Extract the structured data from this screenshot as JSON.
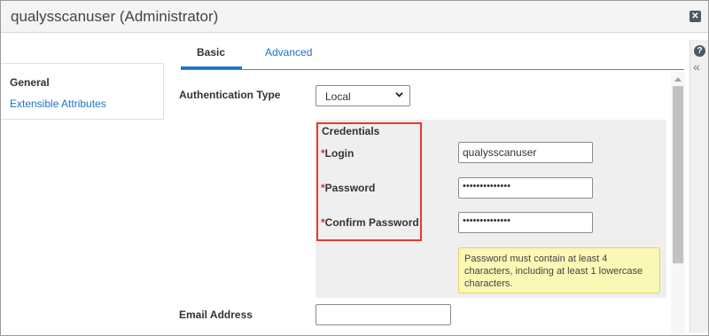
{
  "window": {
    "title": "qualysscanuser (Administrator)",
    "close_icon": "close-icon"
  },
  "left_nav": {
    "items": [
      {
        "label": "General"
      },
      {
        "label": "Extensible Attributes"
      }
    ]
  },
  "tabs": [
    {
      "label": "Basic",
      "active": true
    },
    {
      "label": "Advanced",
      "active": false
    }
  ],
  "form": {
    "auth_type_label": "Authentication Type",
    "auth_type_value": "Local",
    "credentials_title": "Credentials",
    "required_mark": "*",
    "login_label": "Login",
    "login_value": "qualysscanuser",
    "password_label": "Password",
    "password_value": "••••••••••••••",
    "confirm_label": "Confirm Password",
    "confirm_value": "••••••••••••••",
    "hint": "Password must contain at least 4 characters, including at least 1 lowercase characters.",
    "email_label": "Email Address",
    "email_value": ""
  },
  "colors": {
    "accent": "#1a73c8",
    "highlight_border": "#e53935",
    "hint_bg": "#fbf8b5"
  }
}
